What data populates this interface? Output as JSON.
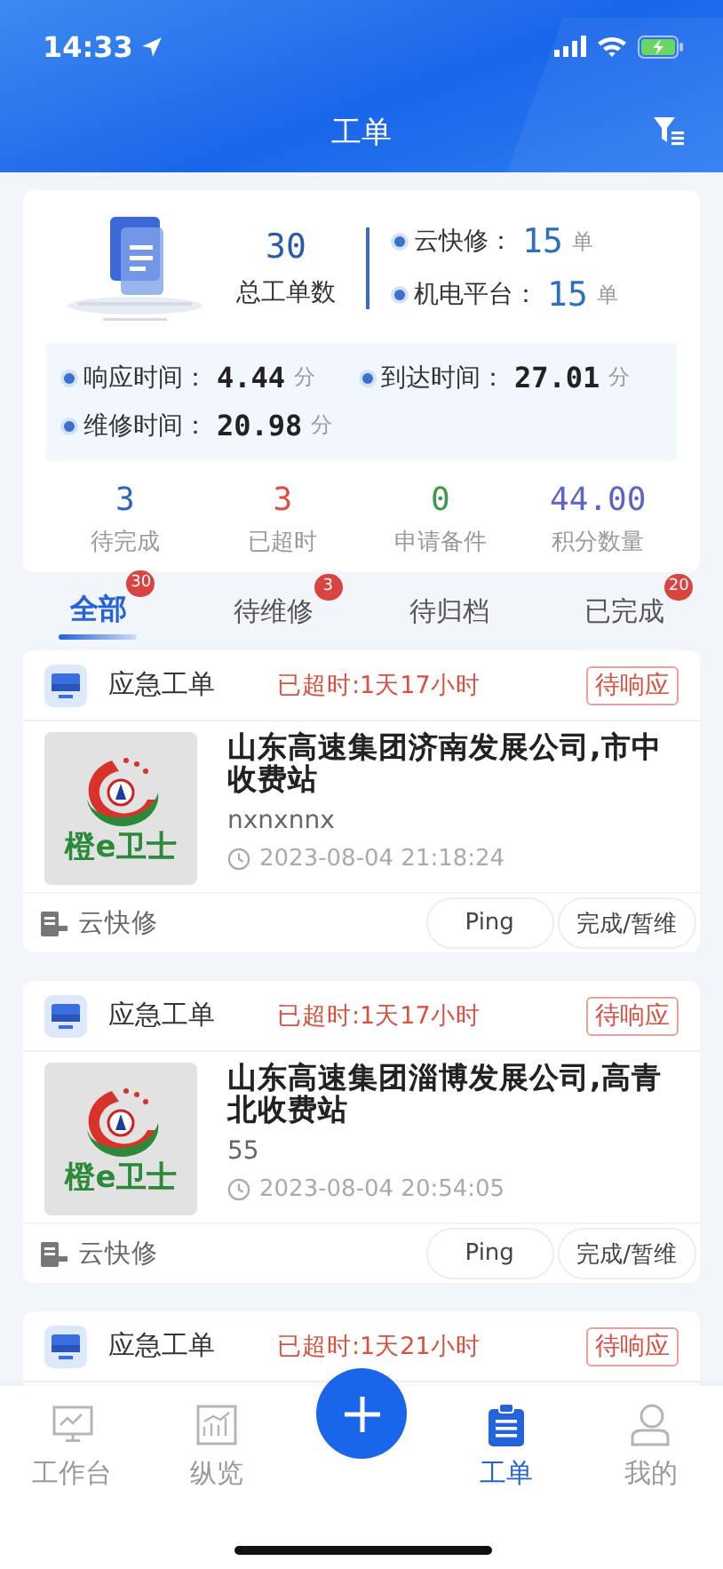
{
  "status_bar": {
    "time": "14:33"
  },
  "header": {
    "title": "工单"
  },
  "summary": {
    "total": "30",
    "total_label": "总工单数",
    "platforms": [
      {
        "label": "云快修：",
        "count": "15",
        "unit": "单"
      },
      {
        "label": "机电平台：",
        "count": "15",
        "unit": "单"
      }
    ],
    "times": [
      {
        "label": "响应时间：",
        "value": "4.44",
        "unit": "分"
      },
      {
        "label": "到达时间：",
        "value": "27.01",
        "unit": "分"
      },
      {
        "label": "维修时间：",
        "value": "20.98",
        "unit": "分"
      }
    ],
    "stats": [
      {
        "value": "3",
        "label": "待完成",
        "color": "#2f63b5"
      },
      {
        "value": "3",
        "label": "已超时",
        "color": "#d9503f"
      },
      {
        "value": "0",
        "label": "申请备件",
        "color": "#3c9a4c"
      },
      {
        "value": "44.00",
        "label": "积分数量",
        "color": "#5c64c6"
      }
    ]
  },
  "tabs": [
    {
      "label": "全部",
      "badge": "30",
      "selected": true
    },
    {
      "label": "待维修",
      "badge": "3",
      "selected": false
    },
    {
      "label": "待归档",
      "selected": false
    },
    {
      "label": "已完成",
      "badge": "20",
      "selected": false
    }
  ],
  "orders": [
    {
      "type": "应急工单",
      "overdue": "已超时:1天17小时",
      "status": "待响应",
      "logo_text": "橙e卫士",
      "title": "山东高速集团济南发展公司,市中收费站",
      "note": "nxnxnnx",
      "time": "2023-08-04 21:18:24",
      "source": "云快修",
      "actions": [
        "Ping",
        "完成/暂维"
      ]
    },
    {
      "type": "应急工单",
      "overdue": "已超时:1天17小时",
      "status": "待响应",
      "logo_text": "橙e卫士",
      "title": "山东高速集团淄博发展公司,高青北收费站",
      "note": "55",
      "time": "2023-08-04 20:54:05",
      "source": "云快修",
      "actions": [
        "Ping",
        "完成/暂维"
      ]
    },
    {
      "type": "应急工单",
      "overdue": "已超时:1天21小时",
      "status": "待响应"
    }
  ],
  "tab_bar": {
    "items": [
      {
        "label": "工作台",
        "selected": false
      },
      {
        "label": "纵览",
        "selected": false
      },
      {
        "label": "工单",
        "selected": true
      },
      {
        "label": "我的",
        "selected": false
      }
    ]
  }
}
